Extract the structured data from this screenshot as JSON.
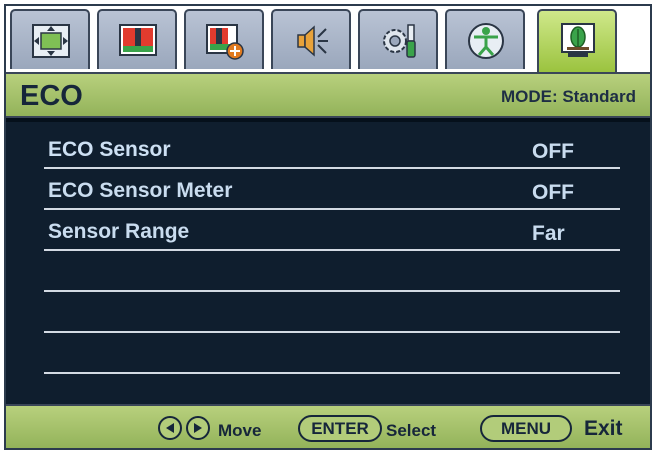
{
  "tabs": [
    {
      "icon": "display-position-icon"
    },
    {
      "icon": "picture-bars-icon"
    },
    {
      "icon": "picture-advanced-icon"
    },
    {
      "icon": "speaker-audio-icon"
    },
    {
      "icon": "system-settings-icon"
    },
    {
      "icon": "accessibility-person-icon"
    },
    {
      "icon": "eco-monitor-icon",
      "active": true
    }
  ],
  "header": {
    "title": "ECO",
    "mode": "MODE: Standard"
  },
  "menu": {
    "items": [
      {
        "label": "ECO Sensor",
        "value": "OFF"
      },
      {
        "label": "ECO Sensor Meter",
        "value": "OFF"
      },
      {
        "label": "Sensor Range",
        "value": "Far"
      },
      {
        "label": "",
        "value": ""
      },
      {
        "label": "",
        "value": ""
      },
      {
        "label": "",
        "value": ""
      }
    ]
  },
  "footer": {
    "move": "Move",
    "enter": "ENTER",
    "select": "Select",
    "menu": "MENU",
    "exit": "Exit"
  },
  "colors": {
    "accent_green": "#9bc33f",
    "panel_bg": "#0f1e2e",
    "text_light": "#c9dcef"
  }
}
